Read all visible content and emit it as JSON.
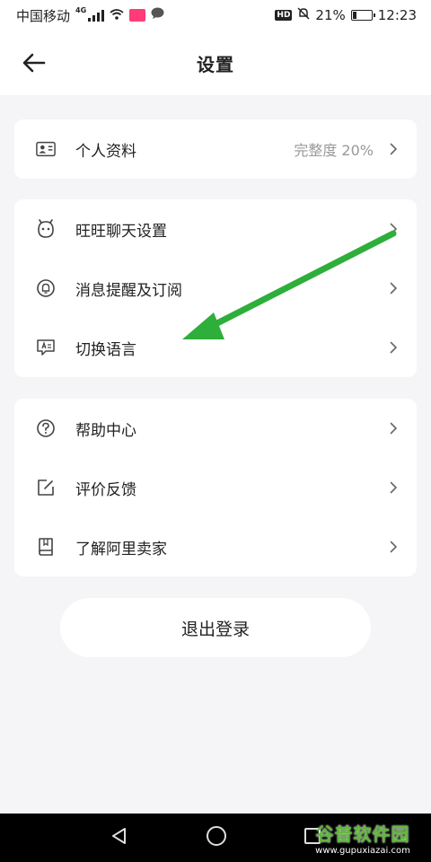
{
  "status_bar": {
    "carrier": "中国移动",
    "network": "4G",
    "battery": "21%",
    "battery_level": 0.21,
    "hd": "HD",
    "time": "12:23"
  },
  "header": {
    "title": "设置"
  },
  "profile_card": {
    "label": "个人资料",
    "value": "完整度 20%",
    "icon": "id-card-icon"
  },
  "settings_group": [
    {
      "label": "旺旺聊天设置",
      "icon": "wangwang-icon"
    },
    {
      "label": "消息提醒及订阅",
      "icon": "bell-icon"
    },
    {
      "label": "切换语言",
      "icon": "translate-icon"
    }
  ],
  "help_group": [
    {
      "label": "帮助中心",
      "icon": "question-icon"
    },
    {
      "label": "评价反馈",
      "icon": "edit-icon"
    },
    {
      "label": "了解阿里卖家",
      "icon": "book-icon"
    }
  ],
  "logout": {
    "label": "退出登录"
  },
  "watermark": {
    "title": "谷普软件园",
    "url": "www.gupuxiazai.com"
  },
  "colors": {
    "background": "#f5f5f7",
    "card": "#ffffff",
    "annotation_arrow": "#2eae3a",
    "watermark": "#5fb83a"
  }
}
